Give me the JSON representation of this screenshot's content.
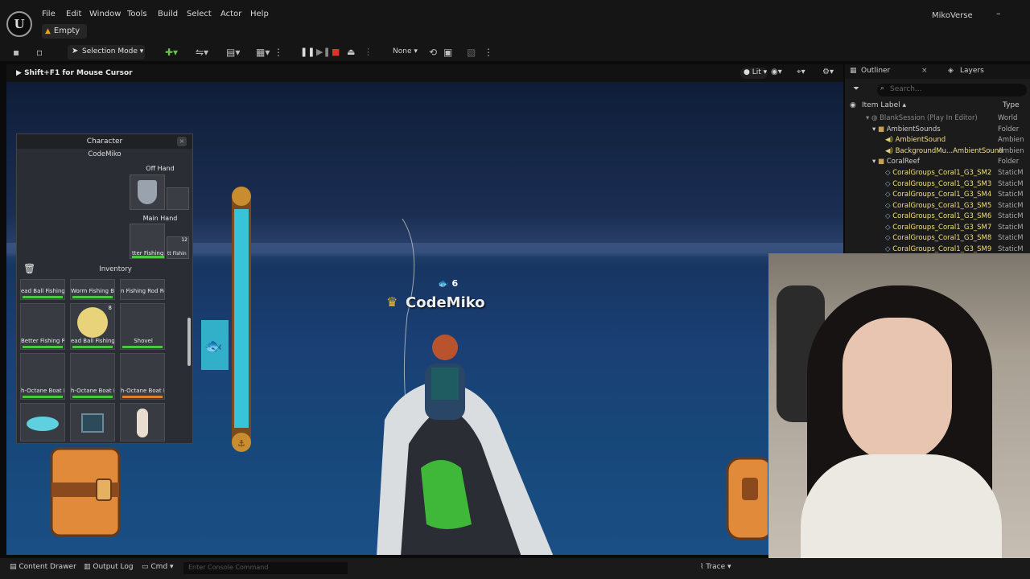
{
  "menu": [
    "File",
    "Edit",
    "Window",
    "Tools",
    "Build",
    "Select",
    "Actor",
    "Help"
  ],
  "app": {
    "logo": "U",
    "level_tab": "Empty",
    "user": "MikoVerse",
    "minimize": "–"
  },
  "toolbar": {
    "selection_mode": "Selection Mode",
    "none_label": "None"
  },
  "viewport": {
    "cursor_hint": "Shift+F1 for Mouse Cursor",
    "lit_label": "Lit"
  },
  "outliner": {
    "tab_outliner": "Outliner",
    "tab_layers": "Layers",
    "search_placeholder": "Search...",
    "col_label": "Item Label ▴",
    "col_type": "Type",
    "rows": [
      {
        "label": "BlankSession (Play In Editor)",
        "type": "World"
      },
      {
        "label": "AmbientSounds",
        "type": "Folder"
      },
      {
        "label": "AmbientSound",
        "type": "Ambien"
      },
      {
        "label": "BackgroundMu...AmbientSound",
        "type": "Ambien"
      },
      {
        "label": "CoralReef",
        "type": "Folder"
      },
      {
        "label": "CoralGroups_Coral1_G3_SM2",
        "type": "StaticM"
      },
      {
        "label": "CoralGroups_Coral1_G3_SM3",
        "type": "StaticM"
      },
      {
        "label": "CoralGroups_Coral1_G3_SM4",
        "type": "StaticM"
      },
      {
        "label": "CoralGroups_Coral1_G3_SM5",
        "type": "StaticM"
      },
      {
        "label": "CoralGroups_Coral1_G3_SM6",
        "type": "StaticM"
      },
      {
        "label": "CoralGroups_Coral1_G3_SM7",
        "type": "StaticM"
      },
      {
        "label": "CoralGroups_Coral1_G3_SM8",
        "type": "StaticM"
      },
      {
        "label": "CoralGroups_Coral1_G3_SM9",
        "type": "StaticM"
      }
    ]
  },
  "character": {
    "title": "Character",
    "name": "CodeMiko",
    "off_hand": "Off Hand",
    "main_hand": "Main Hand",
    "main_hand_item": "tter Fishing",
    "main_hand_item2": "tt Fishin",
    "inventory": "Inventory",
    "items": [
      {
        "name": "ead Ball Fishing B",
        "bar": "green"
      },
      {
        "name": "Worm Fishing Bait",
        "bar": "green"
      },
      {
        "name": "n Fishing Rod Rep",
        "bar": "none"
      },
      {
        "name": "Better Fishing Rod",
        "bar": "green"
      },
      {
        "name": "ead Ball Fishing B",
        "bar": "green"
      },
      {
        "name": "Shovel",
        "bar": "green"
      },
      {
        "name": "h-Octane Boat F",
        "bar": "green"
      },
      {
        "name": "h-Octane Boat F",
        "bar": "green"
      },
      {
        "name": "h-Octane Boat F",
        "bar": "orange"
      },
      {
        "name": "",
        "bar": "none"
      },
      {
        "name": "",
        "bar": "none"
      },
      {
        "name": "",
        "bar": "none"
      }
    ],
    "stack_count": "8",
    "slot_count": "12"
  },
  "player": {
    "name": "CodeMiko",
    "fish_count": "6"
  },
  "bottom": {
    "content_drawer": "Content Drawer",
    "output_log": "Output Log",
    "cmd": "Cmd",
    "console_placeholder": "Enter Console Command",
    "trace": "Trace"
  }
}
